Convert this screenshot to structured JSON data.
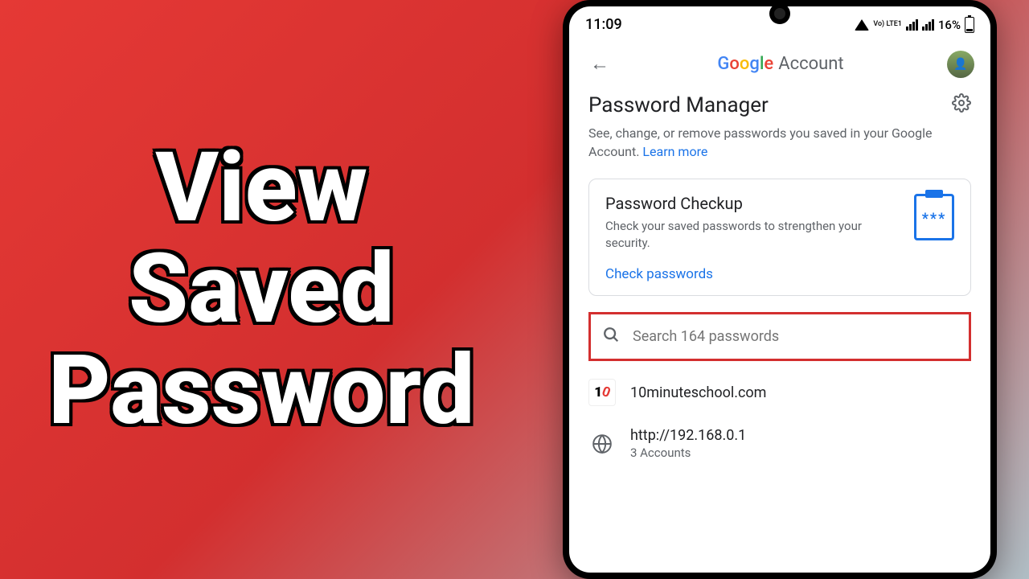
{
  "thumbnail": {
    "line1": "View",
    "line2": "Saved",
    "line3": "Password"
  },
  "status": {
    "time": "11:09",
    "lte_label": "Vo)\nLTE1",
    "battery": "16%"
  },
  "header": {
    "title_google": "Google",
    "title_account": "Account"
  },
  "pm": {
    "title": "Password Manager",
    "desc": "See, change, or remove passwords you saved in your Google Account. ",
    "learn_more": "Learn more"
  },
  "checkup": {
    "title": "Password Checkup",
    "desc": "Check your saved passwords to strengthen your security.",
    "link": "Check passwords"
  },
  "search": {
    "placeholder": "Search 164 passwords"
  },
  "items": [
    {
      "name": "10minuteschool.com",
      "sub": ""
    },
    {
      "name": "http://192.168.0.1",
      "sub": "3 Accounts"
    }
  ]
}
